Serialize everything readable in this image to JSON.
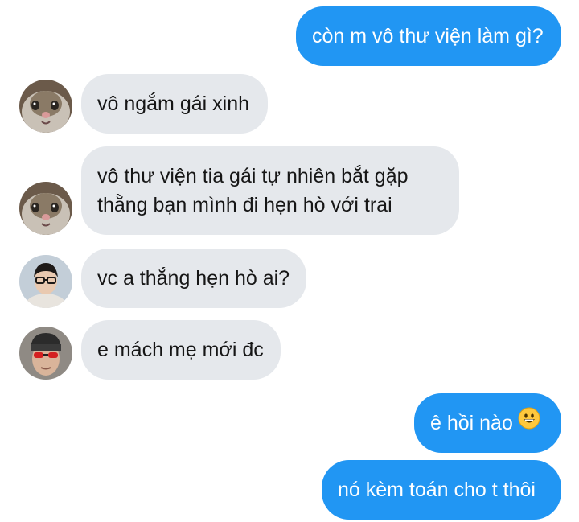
{
  "chat": {
    "messages": [
      {
        "sender": "me",
        "text": "còn m vô thư viện làm gì?"
      },
      {
        "sender": "cat",
        "text": "vô ngắm gái xinh"
      },
      {
        "sender": "cat",
        "lines": [
          "vô thư viện tia gái tự nhiên bắt gặp",
          "thằng bạn mình đi hẹn hò với trai"
        ]
      },
      {
        "sender": "glasses-person",
        "text": "vc a thắng hẹn hò ai?"
      },
      {
        "sender": "beanie-person",
        "text": "e mách mẹ mới đc"
      },
      {
        "sender": "me",
        "text": "ê hồi nào",
        "emoji": "grinning-face"
      },
      {
        "sender": "me",
        "text": "nó kèm toán cho t thôi"
      }
    ]
  },
  "colors": {
    "outgoing_bubble": "#2196f3",
    "incoming_bubble": "#e5e8ec",
    "outgoing_text": "#ffffff",
    "incoming_text": "#161616"
  }
}
